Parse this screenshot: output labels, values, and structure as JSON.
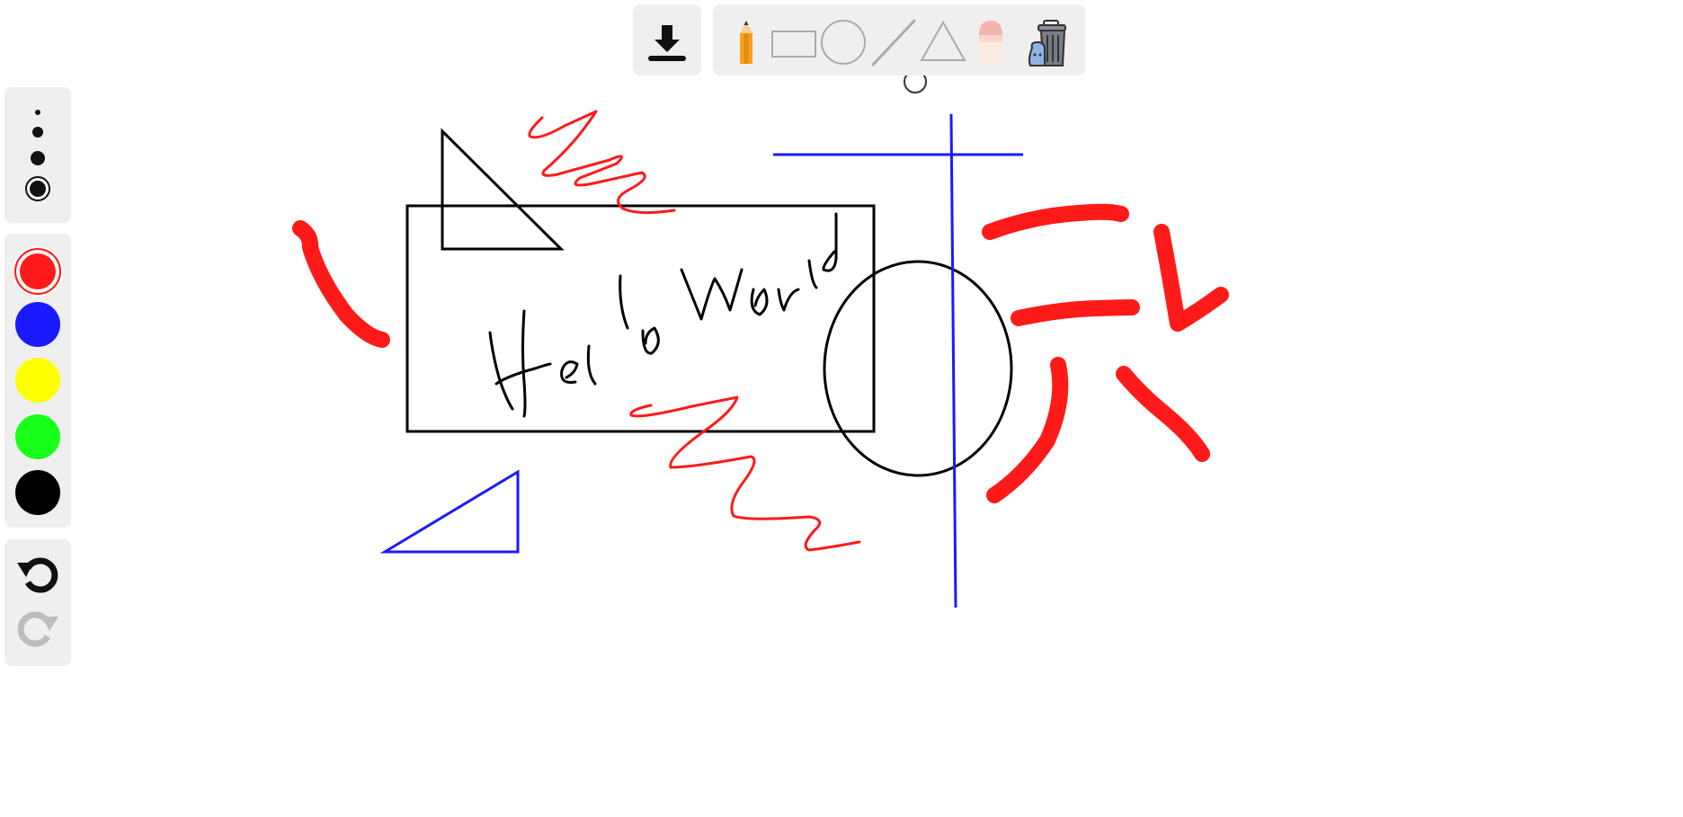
{
  "app": {
    "canvas_text": "Hello World"
  },
  "toolbar": {
    "download": {
      "icon": "download-icon"
    },
    "tools": [
      {
        "name": "pencil",
        "icon": "pencil-icon",
        "selected": true
      },
      {
        "name": "rectangle",
        "icon": "rectangle-icon",
        "selected": false
      },
      {
        "name": "circle",
        "icon": "circle-icon",
        "selected": false
      },
      {
        "name": "line",
        "icon": "line-icon",
        "selected": false
      },
      {
        "name": "triangle",
        "icon": "triangle-icon",
        "selected": false
      },
      {
        "name": "eraser",
        "icon": "eraser-icon",
        "selected": false
      },
      {
        "name": "clear",
        "icon": "trash-bin-icon",
        "selected": false
      }
    ]
  },
  "brush_sizes": {
    "options": [
      "extra-small",
      "small",
      "medium",
      "large"
    ],
    "selected": "large"
  },
  "colors": {
    "options": [
      "#ff1a1a",
      "#1a1aff",
      "#ffff00",
      "#1aff1a",
      "#000000"
    ],
    "selected": "#ff1a1a"
  },
  "history": {
    "undo": {
      "icon": "undo-icon",
      "enabled": true
    },
    "redo": {
      "icon": "redo-icon",
      "enabled": false
    }
  }
}
